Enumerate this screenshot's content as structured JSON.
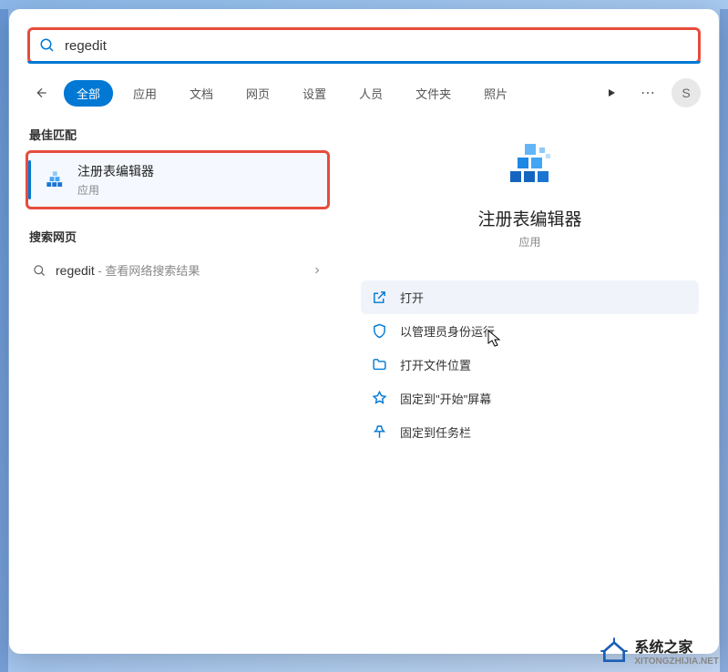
{
  "search": {
    "value": "regedit"
  },
  "tabs": [
    "全部",
    "应用",
    "文档",
    "网页",
    "设置",
    "人员",
    "文件夹",
    "照片"
  ],
  "avatar_initial": "S",
  "left": {
    "best_match_header": "最佳匹配",
    "best_match": {
      "title": "注册表编辑器",
      "subtitle": "应用"
    },
    "web_header": "搜索网页",
    "web_item": {
      "query": "regedit",
      "hint": " - 查看网络搜索结果"
    }
  },
  "preview": {
    "title": "注册表编辑器",
    "subtitle": "应用",
    "actions": {
      "open": "打开",
      "run_admin": "以管理员身份运行",
      "open_location": "打开文件位置",
      "pin_start": "固定到\"开始\"屏幕",
      "pin_taskbar": "固定到任务栏"
    }
  },
  "watermark": {
    "text": "系统之家",
    "url": "XITONGZHIJIA.NET"
  }
}
